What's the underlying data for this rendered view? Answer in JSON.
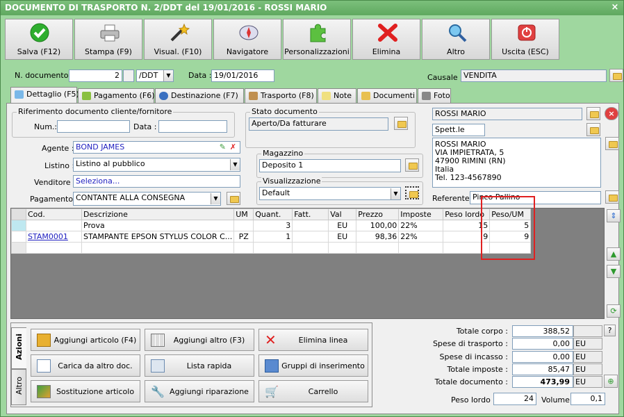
{
  "window": {
    "title": "DOCUMENTO DI TRASPORTO N. 2/DDT del 19/01/2016 - ROSSI MARIO",
    "close_glyph": "×"
  },
  "toolbar": [
    {
      "label": "Salva (F12)",
      "icon": "check-icon"
    },
    {
      "label": "Stampa (F9)",
      "icon": "printer-icon"
    },
    {
      "label": "Visual. (F10)",
      "icon": "magic-wand-icon"
    },
    {
      "label": "Navigatore",
      "icon": "compass-icon"
    },
    {
      "label": "Personalizzazioni",
      "icon": "puzzle-icon"
    },
    {
      "label": "Elimina",
      "icon": "delete-x-icon"
    },
    {
      "label": "Altro",
      "icon": "magnifier-icon"
    },
    {
      "label": "Uscita (ESC)",
      "icon": "power-icon"
    }
  ],
  "header": {
    "ndoc_label": "N. documento :",
    "ndoc_value": "2",
    "series_value": "/DDT",
    "data_label": "Data :",
    "data_value": "19/01/2016",
    "causale_label": "Causale :",
    "causale_value": "VENDITA"
  },
  "tabs": [
    "Dettaglio (F5)",
    "Pagamento (F6)",
    "Destinazione (F7)",
    "Trasporto (F8)",
    "Note",
    "Documenti",
    "Foto"
  ],
  "rif": {
    "group_label": "Riferimento documento cliente/fornitore",
    "num_label": "Num.:",
    "num_value": "",
    "data_label": "Data :",
    "data_value": ""
  },
  "fields": {
    "agente_label": "Agente :",
    "agente_value": "BOND JAMES",
    "listino_label": "Listino :",
    "listino_value": "Listino al pubblico",
    "venditore_label": "Venditore :",
    "venditore_value": "Seleziona...",
    "pagamento_label": "Pagamento :",
    "pagamento_value": "CONTANTE ALLA CONSEGNA"
  },
  "stato": {
    "group_label": "Stato documento",
    "value": "Aperto/Da fatturare"
  },
  "magazzino": {
    "group_label": "Magazzino",
    "value": "Deposito 1"
  },
  "visualizzazione": {
    "group_label": "Visualizzazione",
    "value": "Default"
  },
  "cliente": {
    "name": "ROSSI MARIO",
    "title": "Spett.le",
    "address_lines": [
      "ROSSI MARIO",
      "VIA IMPIETRATA, 5",
      "47900 RIMINI (RN)",
      "Italia",
      "Tel. 123-4567890"
    ],
    "referente_label": "Referente",
    "referente_value": "Pinco Pallino"
  },
  "grid": {
    "columns": [
      "Cod.",
      "Descrizione",
      "UM",
      "Quant.",
      "Fatt.",
      "Val",
      "Prezzo",
      "Imposte",
      "Peso lordo",
      "Peso/UM"
    ],
    "rows": [
      {
        "cod": "",
        "descr": "Prova",
        "um": "",
        "quant": "3",
        "fatt": "",
        "val": "EU",
        "prezzo": "100,00",
        "imposte": "22%",
        "peso_lordo": "15",
        "peso_um": "5"
      },
      {
        "cod": "STAM0001",
        "descr": "STAMPANTE EPSON STYLUS COLOR C...",
        "um": "PZ",
        "quant": "1",
        "fatt": "",
        "val": "EU",
        "prezzo": "98,36",
        "imposte": "22%",
        "peso_lordo": "9",
        "peso_um": "9"
      }
    ]
  },
  "actions": {
    "vtabs": [
      "Azioni",
      "Altro"
    ],
    "buttons": [
      {
        "label": "Aggiungi articolo (F4)",
        "icon": "add-box-icon"
      },
      {
        "label": "Aggiungi altro (F3)",
        "icon": "add-grid-icon"
      },
      {
        "label": "Elimina linea",
        "icon": "delete-x-icon"
      },
      {
        "label": "Carica da altro doc.",
        "icon": "load-doc-icon"
      },
      {
        "label": "Lista rapida",
        "icon": "quick-list-icon"
      },
      {
        "label": "Gruppi di inserimento",
        "icon": "group-add-icon"
      },
      {
        "label": "Sostituzione articolo",
        "icon": "swap-icon"
      },
      {
        "label": "Aggiungi riparazione",
        "icon": "wrench-icon"
      },
      {
        "label": "Carrello",
        "icon": "cart-icon"
      }
    ]
  },
  "totals": {
    "corpo_label": "Totale corpo :",
    "corpo_value": "388,52",
    "trasporto_label": "Spese di trasporto :",
    "trasporto_value": "0,00",
    "trasporto_cur": "EU",
    "incasso_label": "Spese di incasso :",
    "incasso_value": "0,00",
    "incasso_cur": "EU",
    "imposte_label": "Totale imposte :",
    "imposte_value": "85,47",
    "imposte_cur": "EU",
    "documento_label": "Totale documento :",
    "documento_value": "473,99",
    "documento_cur": "EU",
    "peso_label": "Peso lordo :",
    "peso_value": "24",
    "volume_label": "Volume :",
    "volume_value": "0,1",
    "help_glyph": "?"
  }
}
